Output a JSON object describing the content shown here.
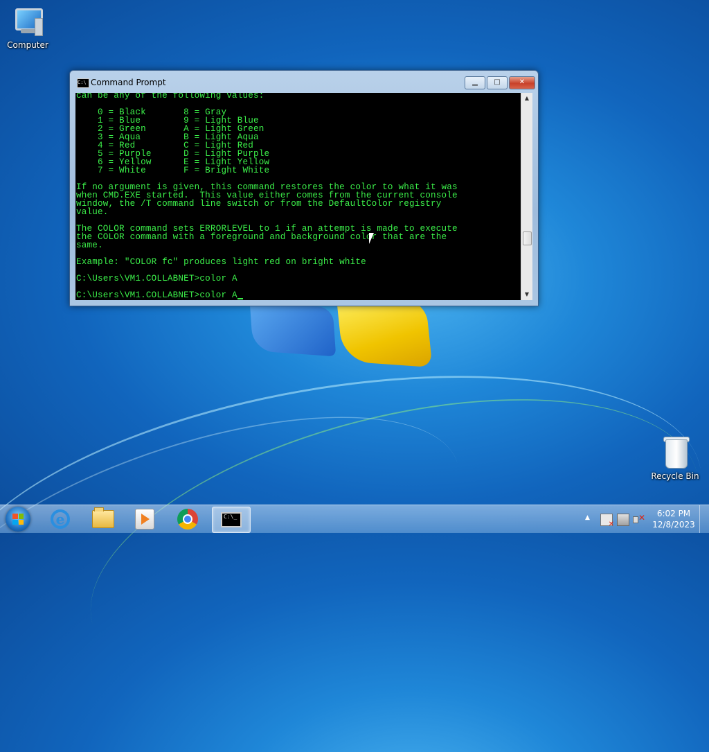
{
  "desktop": {
    "icons": [
      {
        "label": "Computer"
      },
      {
        "label": "Recycle Bin"
      }
    ]
  },
  "window": {
    "title": "Command Prompt",
    "buttons": {
      "minimize": "▁",
      "maximize": "□",
      "close": "✕"
    },
    "console_lines": [
      "can be any of the following values:",
      "",
      "    0 = Black       8 = Gray",
      "    1 = Blue        9 = Light Blue",
      "    2 = Green       A = Light Green",
      "    3 = Aqua        B = Light Aqua",
      "    4 = Red         C = Light Red",
      "    5 = Purple      D = Light Purple",
      "    6 = Yellow      E = Light Yellow",
      "    7 = White       F = Bright White",
      "",
      "If no argument is given, this command restores the color to what it was",
      "when CMD.EXE started.  This value either comes from the current console",
      "window, the /T command line switch or from the DefaultColor registry",
      "value.",
      "",
      "The COLOR command sets ERRORLEVEL to 1 if an attempt is made to execute",
      "the COLOR command with a foreground and background color that are the",
      "same.",
      "",
      "Example: \"COLOR fc\" produces light red on bright white",
      "",
      "C:\\Users\\VM1.COLLABNET>color A",
      ""
    ],
    "prompt_line": "C:\\Users\\VM1.COLLABNET>color A",
    "text_color": "#3cf04a",
    "background_color": "#000000"
  },
  "taskbar": {
    "pinned": [
      {
        "name": "Internet Explorer",
        "icon": "internet-explorer-icon"
      },
      {
        "name": "Windows Explorer",
        "icon": "folder-icon"
      },
      {
        "name": "Windows Media Player",
        "icon": "media-player-icon"
      },
      {
        "name": "Google Chrome",
        "icon": "chrome-icon"
      },
      {
        "name": "Command Prompt",
        "icon": "cmd-icon",
        "active": true
      }
    ],
    "tray": {
      "show_hidden": "▲",
      "time": "6:02 PM",
      "date": "12/8/2023"
    }
  },
  "colors": {
    "accent": "#1f87d8",
    "console_text": "#3cf04a"
  }
}
